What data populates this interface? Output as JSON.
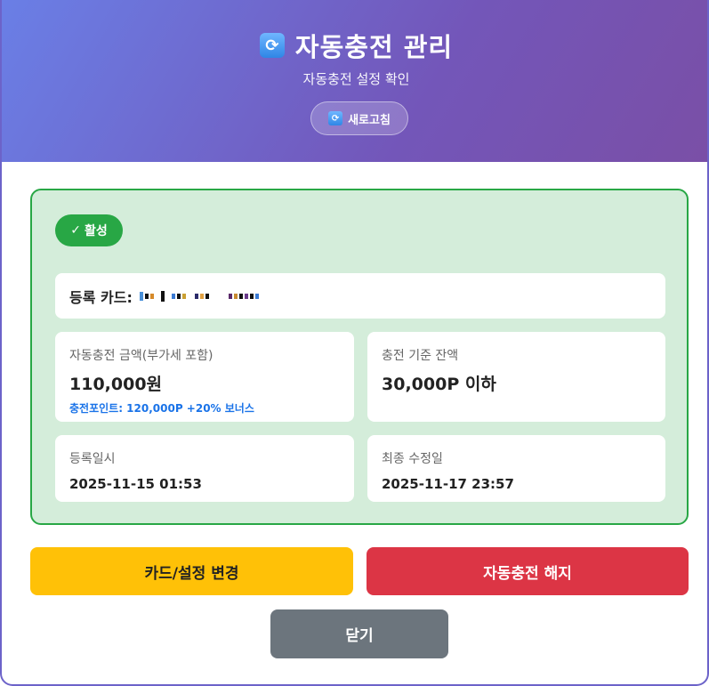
{
  "header": {
    "icon": "refresh-icon",
    "title": "자동충전 관리",
    "subtitle": "자동충전 설정 확인",
    "refresh_label": "새로고침"
  },
  "status": {
    "badge_check": "✓",
    "badge_label": "활성",
    "badge_color": "#28a745",
    "panel_bg": "#d4edda"
  },
  "card": {
    "label": "등록 카드:"
  },
  "details": {
    "amount_label": "자동충전 금액(부가세 포함)",
    "amount_value": "110,000원",
    "amount_note": "충전포인트: 120,000P +20% 보너스",
    "threshold_label": "충전 기준 잔액",
    "threshold_value": "30,000P 이하",
    "registered_label": "등록일시",
    "registered_value": "2025-11-15 01:53",
    "modified_label": "최종 수정일",
    "modified_value": "2025-11-17 23:57"
  },
  "actions": {
    "change_label": "카드/설정 변경",
    "cancel_label": "자동충전 해지",
    "close_label": "닫기",
    "change_color": "#ffc107",
    "cancel_color": "#dc3545",
    "close_color": "#6c757d"
  }
}
